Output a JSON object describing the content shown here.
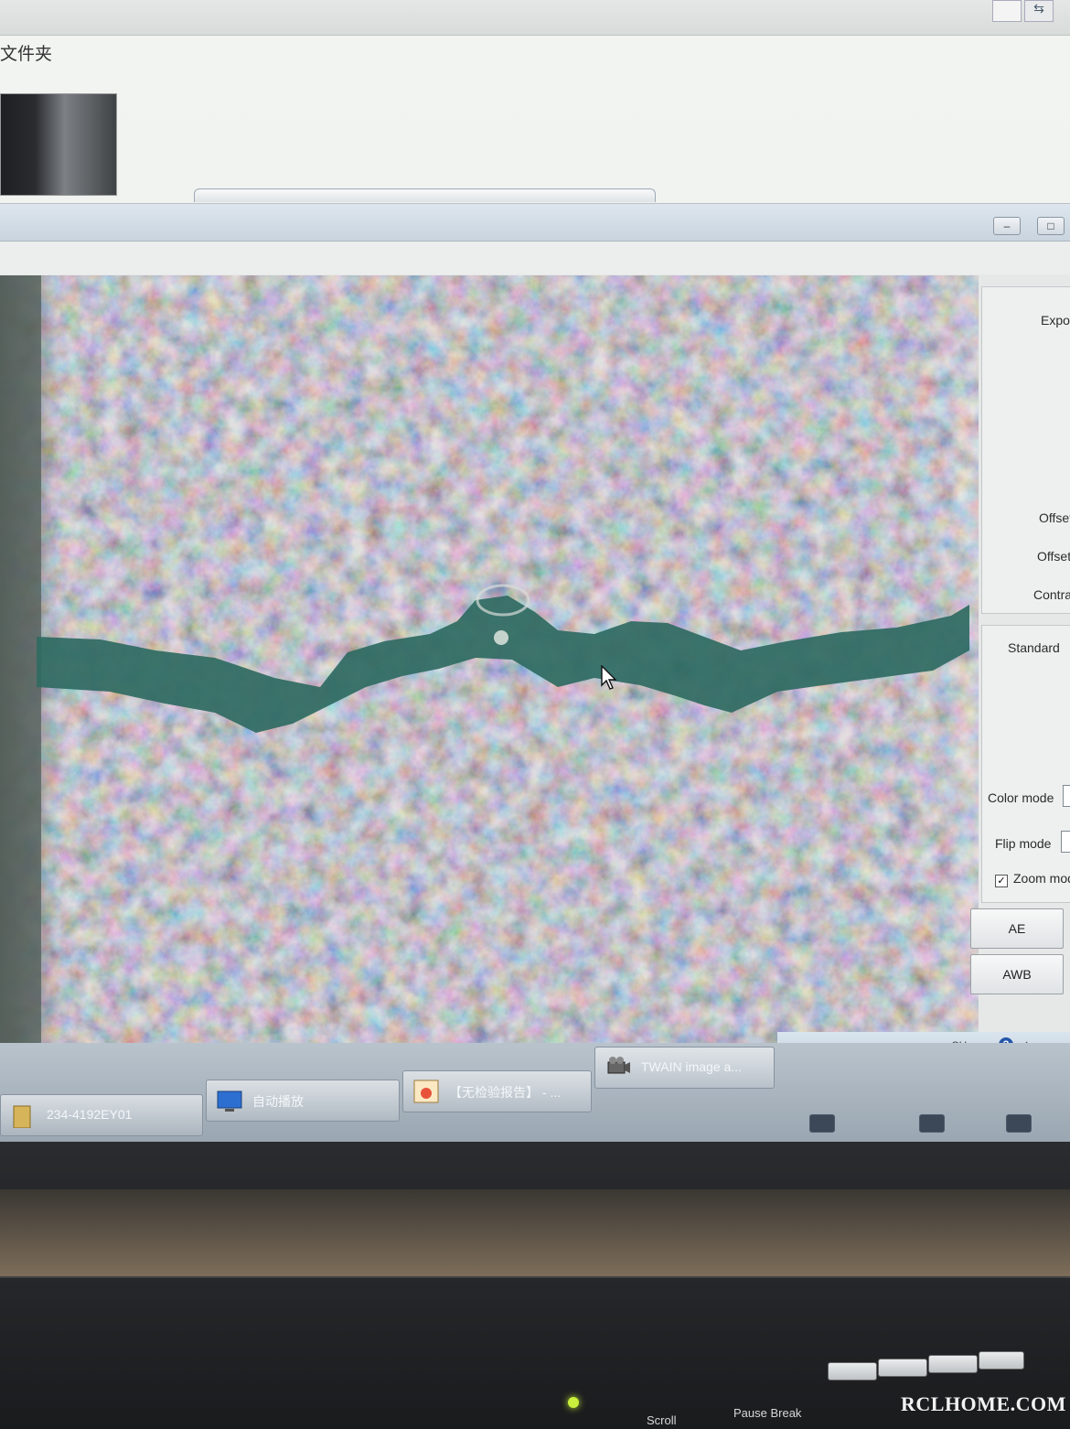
{
  "explorer": {
    "folder_label": "文件夹"
  },
  "panel": {
    "exposure_label": "Expo",
    "offset1_label": "Offset",
    "offset2_label": "Offset",
    "contrast_label": "Contra",
    "standard_label": "Standard",
    "color_mode_label": "Color mode",
    "flip_mode_label": "Flip mode",
    "zoom_mode_label": "Zoom mod",
    "zoom_mode_checked": true,
    "ae_button": "AE",
    "awb_button": "AWB"
  },
  "tray": {
    "lang": "CH"
  },
  "taskbar": {
    "items": [
      {
        "label": "234-4192EY01",
        "icon": "folder-icon"
      },
      {
        "label": "自动播放",
        "icon": "monitor-icon"
      },
      {
        "label": "【无检验报告】 - ...",
        "icon": "image-viewer-icon"
      },
      {
        "label": "TWAIN image a...",
        "icon": "camera-icon"
      }
    ]
  },
  "keyboard": {
    "keys": [
      "Scroll",
      "Pause Break"
    ]
  },
  "watermark": "RCLHOME.COM",
  "colors": {
    "crack": "#2f6a62",
    "surface": "#9c8c84"
  }
}
